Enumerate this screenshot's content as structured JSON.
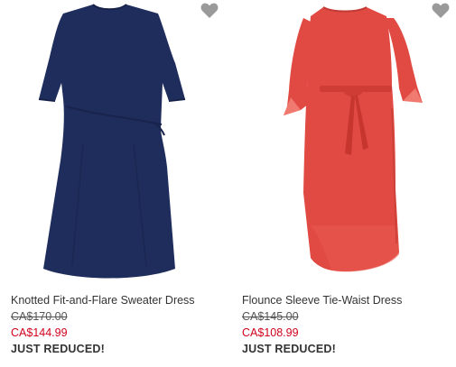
{
  "products": [
    {
      "name": "Knotted Fit-and-Flare Sweater Dress",
      "original_price": "CA$170.00",
      "sale_price": "CA$144.99",
      "badge": "JUST REDUCED!",
      "dress_color": "#1f2d5c",
      "favorite_icon": "heart-icon",
      "favorited": false
    },
    {
      "name": "Flounce Sleeve Tie-Waist Dress",
      "original_price": "CA$145.00",
      "sale_price": "CA$108.99",
      "badge": "JUST REDUCED!",
      "dress_color": "#e04a43",
      "favorite_icon": "heart-icon",
      "favorited": false
    }
  ],
  "colors": {
    "sale_price": "#d0021b",
    "heart_icon": "#9a9a9a",
    "text": "#333333"
  }
}
